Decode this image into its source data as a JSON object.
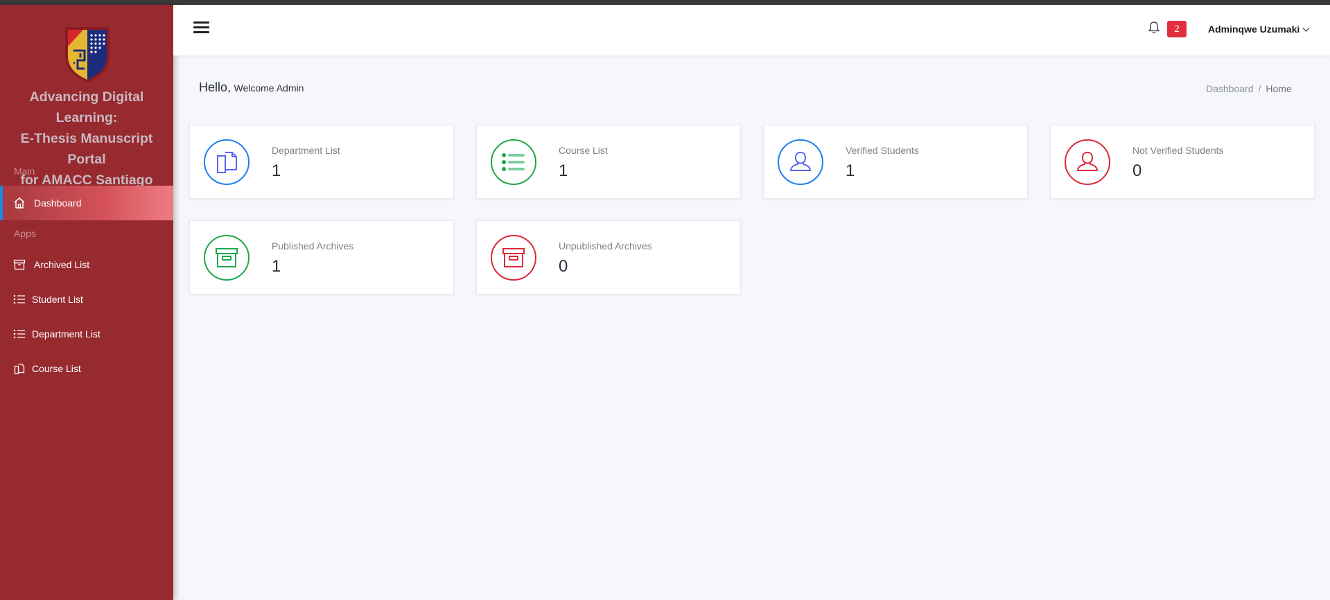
{
  "sidebar": {
    "brand_title": [
      "Advancing Digital Learning:",
      "E-Thesis Manuscript Portal",
      "for AMACC Santiago"
    ],
    "sections": {
      "main": "Main",
      "apps": "Apps"
    },
    "items": [
      {
        "label": "Dashboard",
        "icon": "home-icon",
        "active": true
      },
      {
        "label": "Archived List",
        "icon": "archive-icon"
      },
      {
        "label": "Student List",
        "icon": "list-icon"
      },
      {
        "label": "Department List",
        "icon": "list-icon"
      },
      {
        "label": "Course List",
        "icon": "copy-icon"
      }
    ]
  },
  "header": {
    "notification_count": "2",
    "user_name": "Adminqwe Uzumaki"
  },
  "page": {
    "greeting": "Hello,",
    "greeting_sub": "Welcome Admin",
    "breadcrumb": [
      "Dashboard",
      "Home"
    ]
  },
  "cards": [
    {
      "label": "Department List",
      "value": "1",
      "icon": "copy-icon",
      "color": "#1e7ef0"
    },
    {
      "label": "Course List",
      "value": "1",
      "icon": "list-icon",
      "color": "#1ea84a"
    },
    {
      "label": "Verified Students",
      "value": "1",
      "icon": "user-icon",
      "color": "#1e7ef0"
    },
    {
      "label": "Not Verified Students",
      "value": "0",
      "icon": "user-icon",
      "color": "#dc2a3a"
    },
    {
      "label": "Published Archives",
      "value": "1",
      "icon": "archive-icon",
      "color": "#1ea84a"
    },
    {
      "label": "Unpublished Archives",
      "value": "0",
      "icon": "archive-icon",
      "color": "#dc2a3a"
    }
  ],
  "colors": {
    "sidebar_bg": "#972a2f",
    "active_accent": "#1e88e5",
    "badge": "#e0303f"
  }
}
